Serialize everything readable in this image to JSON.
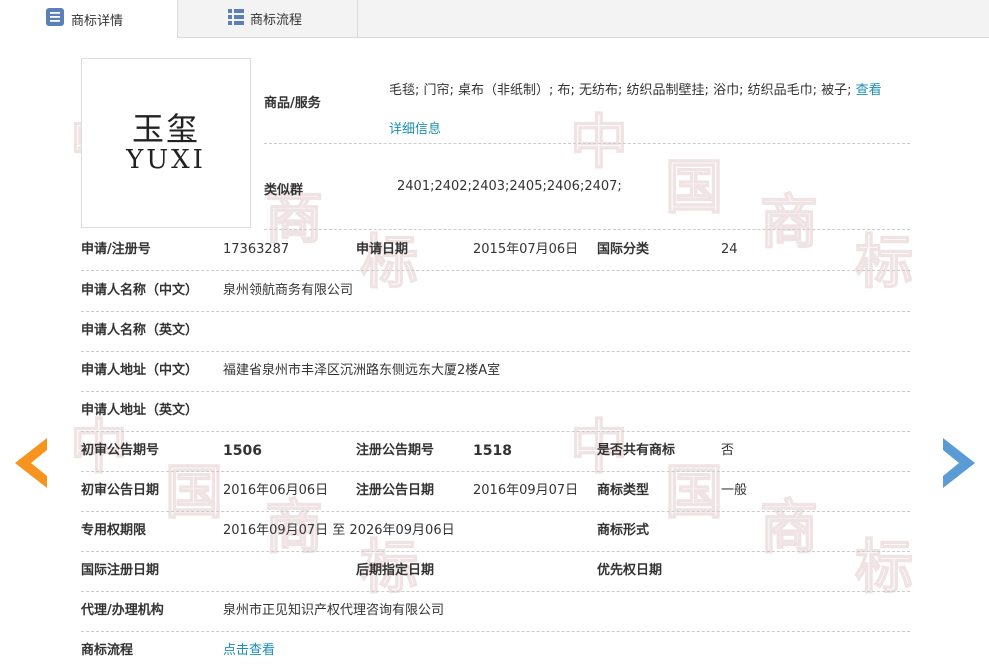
{
  "tabs": [
    {
      "label": "商标详情",
      "active": true,
      "icon": "document-list-icon"
    },
    {
      "label": "商标流程",
      "active": false,
      "icon": "grid-icon"
    }
  ],
  "watermark": [
    "中",
    "国",
    "商",
    "标"
  ],
  "logo": {
    "chinese": "玉玺",
    "english": "YUXI"
  },
  "goods": {
    "label": "商品/服务",
    "text": "毛毯; 门帘; 桌布（非纸制）; 布; 无纺布; 纺织品制壁挂; 浴巾; 纺织品毛巾; 被子; ",
    "link1": "查看",
    "link2": "详细信息"
  },
  "similar_group": {
    "label": "类似群",
    "value": "2401;2402;2403;2405;2406;2407;"
  },
  "rows": {
    "r1": {
      "l1": "申请/注册号",
      "v1": "17363287",
      "l2": "申请日期",
      "v2": "2015年07月06日",
      "l3": "国际分类",
      "v3": "24"
    },
    "r2": {
      "l1": "申请人名称（中文）",
      "v1": "泉州领航商务有限公司"
    },
    "r3": {
      "l1": "申请人名称（英文）",
      "v1": ""
    },
    "r4": {
      "l1": "申请人地址（中文）",
      "v1": "福建省泉州市丰泽区沉洲路东侧远东大厦2楼A室"
    },
    "r5": {
      "l1": "申请人地址（英文）",
      "v1": ""
    },
    "r6": {
      "l1": "初审公告期号",
      "v1": "1506",
      "l2": "注册公告期号",
      "v2": "1518",
      "l3": "是否共有商标",
      "v3": "否"
    },
    "r7": {
      "l1": "初审公告日期",
      "v1": "2016年06月06日",
      "l2": "注册公告日期",
      "v2": "2016年09月07日",
      "l3": "商标类型",
      "v3": "一般"
    },
    "r8": {
      "l1": "专用权期限",
      "v1": "2016年09月07日 至 2026年09月06日",
      "l3": "商标形式",
      "v3": ""
    },
    "r9": {
      "l1": "国际注册日期",
      "v1": "",
      "l2": "后期指定日期",
      "v2": "",
      "l3": "优先权日期",
      "v3": ""
    },
    "r10": {
      "l1": "代理/办理机构",
      "v1": "泉州市正见知识产权代理咨询有限公司"
    },
    "r11": {
      "l1": "商标流程",
      "v1": "点击查看"
    }
  },
  "colors": {
    "accent": "#1a8fb3",
    "arrow_left": "#f7941d",
    "arrow_right": "#5b9bd5"
  },
  "nav": {
    "prev": "arrow-left-icon",
    "next": "arrow-right-icon"
  }
}
